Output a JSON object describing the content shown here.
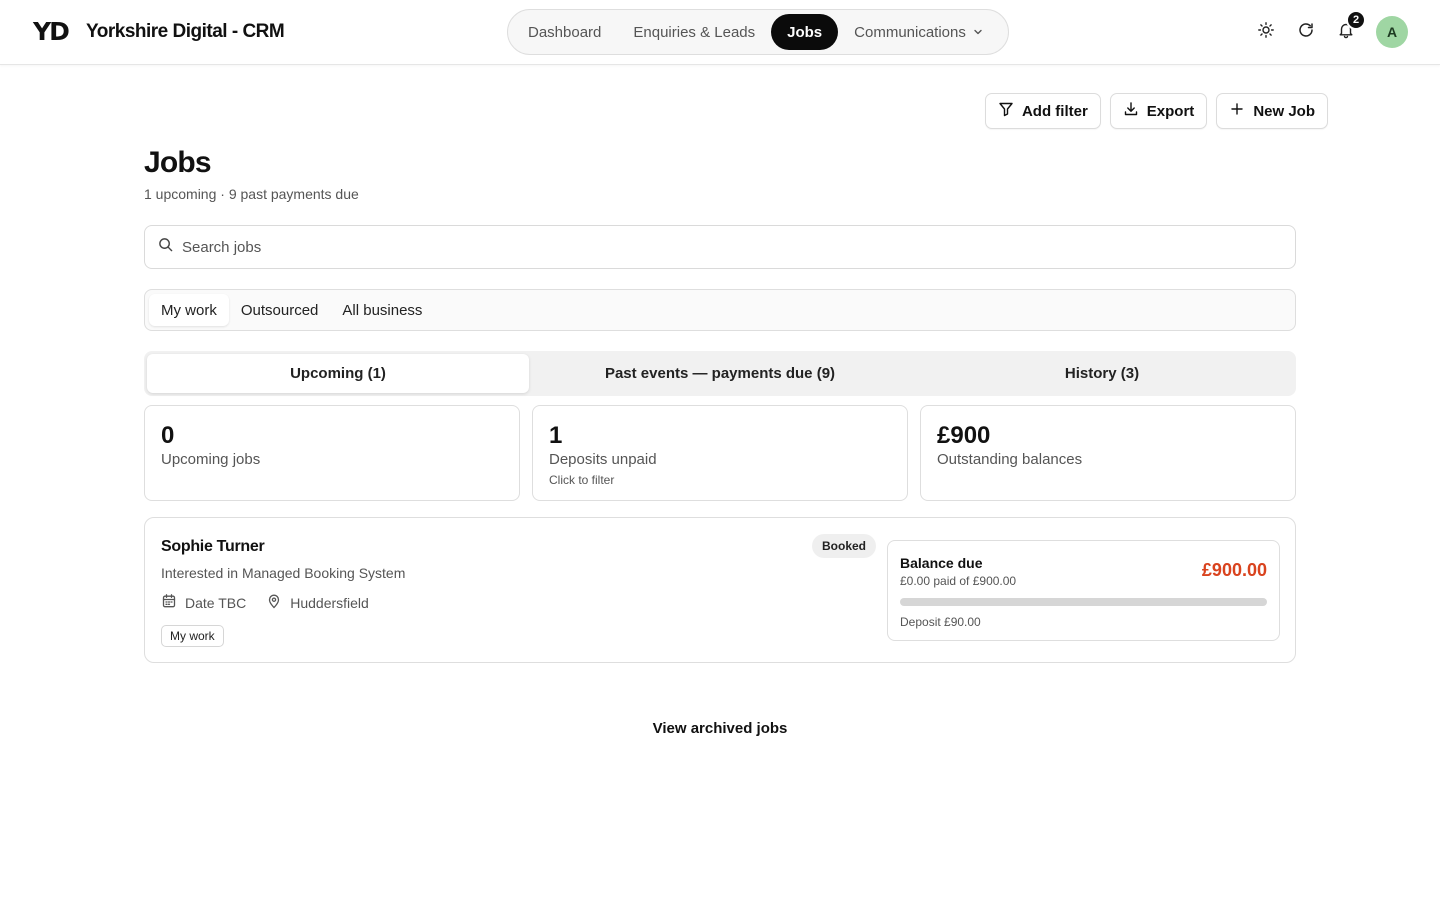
{
  "header": {
    "logo": "YD",
    "app_title": "Yorkshire Digital - CRM",
    "nav": [
      {
        "label": "Dashboard"
      },
      {
        "label": "Enquiries & Leads"
      },
      {
        "label": "Jobs"
      },
      {
        "label": "Communications"
      }
    ],
    "active_nav": "Jobs",
    "notifications_count": "2",
    "avatar_initial": "A",
    "icons": [
      "sun-icon",
      "refresh-icon",
      "bell-icon",
      "chevron-down-icon"
    ]
  },
  "toolbar": {
    "add_filter": "Add filter",
    "export": "Export",
    "new_job": "New Job"
  },
  "page": {
    "title": "Jobs",
    "subtitle": "1 upcoming · 9 past payments due"
  },
  "search": {
    "placeholder": "Search jobs",
    "value": ""
  },
  "scope": {
    "items": [
      {
        "label": "My work"
      },
      {
        "label": "Outsourced"
      },
      {
        "label": "All business"
      }
    ],
    "active": "My work"
  },
  "tabs": {
    "items": [
      {
        "label": "Upcoming (1)"
      },
      {
        "label": "Past events — payments due (9)"
      },
      {
        "label": "History (3)"
      }
    ],
    "active": "Upcoming (1)"
  },
  "stats": [
    {
      "value": "0",
      "label": "Upcoming jobs"
    },
    {
      "value": "1",
      "label": "Deposits unpaid",
      "hint": "Click to filter"
    },
    {
      "value": "£900",
      "label": "Outstanding balances"
    }
  ],
  "jobs": [
    {
      "client": "Sophie Turner",
      "description": "Interested in Managed Booking System",
      "date": "Date TBC",
      "location": "Huddersfield",
      "tag": "My work",
      "status": "Booked",
      "balance": {
        "title": "Balance due",
        "paid_text": "£0.00 paid of £900.00",
        "amount": "£900.00",
        "paid_fraction": 0,
        "deposit": "Deposit £90.00"
      }
    }
  ],
  "archived_link": "View archived jobs",
  "colors": {
    "accent_dark": "#0b0b0b",
    "balance_due": "#d9431e",
    "avatar_bg": "#9fd6a3"
  }
}
